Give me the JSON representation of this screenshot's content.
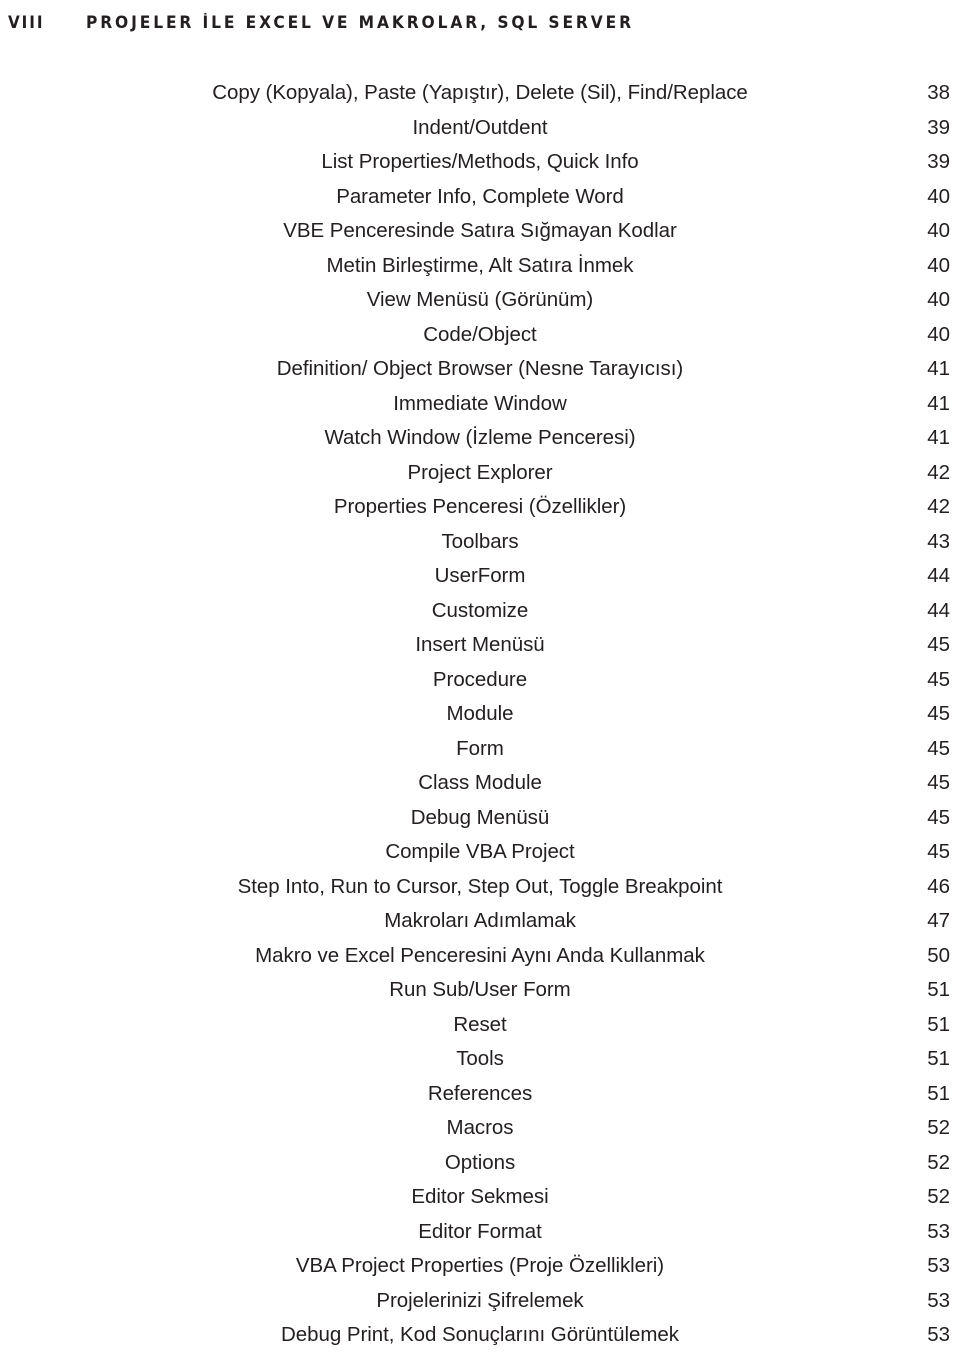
{
  "header": {
    "folio": "VIII",
    "running_title": "PROJELER İLE EXCEL VE MAKROLAR, SQL SERVER"
  },
  "toc": {
    "entries": [
      {
        "title": "Copy (Kopyala), Paste (Yapıştır), Delete (Sil), Find/Replace",
        "page": "38"
      },
      {
        "title": "Indent/Outdent",
        "page": "39"
      },
      {
        "title": "List Properties/Methods, Quick Info",
        "page": "39"
      },
      {
        "title": "Parameter Info, Complete Word",
        "page": "40"
      },
      {
        "title": "VBE Penceresinde Satıra Sığmayan Kodlar",
        "page": "40"
      },
      {
        "title": "Metin Birleştirme, Alt Satıra İnmek",
        "page": "40"
      },
      {
        "title": "View Menüsü (Görünüm)",
        "page": "40"
      },
      {
        "title": "Code/Object",
        "page": "40"
      },
      {
        "title": "Definition/ Object Browser (Nesne Tarayıcısı)",
        "page": "41"
      },
      {
        "title": "Immediate Window",
        "page": "41"
      },
      {
        "title": "Watch Window (İzleme Penceresi)",
        "page": "41"
      },
      {
        "title": "Project Explorer",
        "page": "42"
      },
      {
        "title": "Properties Penceresi (Özellikler)",
        "page": "42"
      },
      {
        "title": "Toolbars",
        "page": "43"
      },
      {
        "title": "UserForm",
        "page": "44"
      },
      {
        "title": "Customize",
        "page": "44"
      },
      {
        "title": "Insert Menüsü",
        "page": "45"
      },
      {
        "title": "Procedure",
        "page": "45"
      },
      {
        "title": "Module",
        "page": "45"
      },
      {
        "title": "Form",
        "page": "45"
      },
      {
        "title": "Class Module",
        "page": "45"
      },
      {
        "title": "Debug Menüsü",
        "page": "45"
      },
      {
        "title": "Compile VBA Project",
        "page": "45"
      },
      {
        "title": "Step Into, Run to Cursor, Step Out, Toggle Breakpoint",
        "page": "46"
      },
      {
        "title": "Makroları Adımlamak",
        "page": "47"
      },
      {
        "title": "Makro ve Excel Penceresini Aynı Anda Kullanmak",
        "page": "50"
      },
      {
        "title": "Run Sub/User Form",
        "page": "51"
      },
      {
        "title": "Reset",
        "page": "51"
      },
      {
        "title": "Tools",
        "page": "51"
      },
      {
        "title": "References",
        "page": "51"
      },
      {
        "title": "Macros",
        "page": "52"
      },
      {
        "title": "Options",
        "page": "52"
      },
      {
        "title": "Editor Sekmesi",
        "page": "52"
      },
      {
        "title": "Editor Format",
        "page": "53"
      },
      {
        "title": "VBA Project Properties (Proje Özellikleri)",
        "page": "53"
      },
      {
        "title": "Projelerinizi Şifrelemek",
        "page": "53"
      },
      {
        "title": "Debug Print, Kod Sonuçlarını Görüntülemek",
        "page": "53"
      }
    ]
  }
}
